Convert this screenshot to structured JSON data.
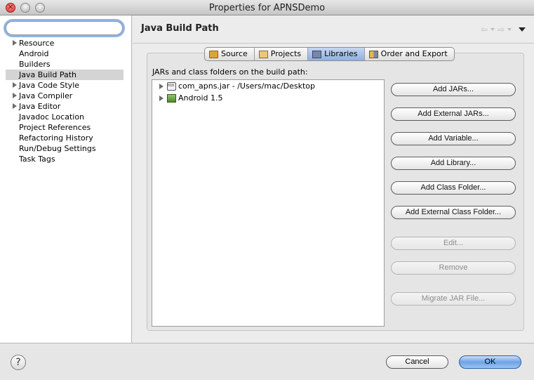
{
  "window": {
    "title": "Properties for APNSDemo"
  },
  "filter": {
    "placeholder": ""
  },
  "sidebar": {
    "items": [
      {
        "label": "Resource",
        "expandable": true
      },
      {
        "label": "Android",
        "expandable": false
      },
      {
        "label": "Builders",
        "expandable": false
      },
      {
        "label": "Java Build Path",
        "expandable": false,
        "selected": true
      },
      {
        "label": "Java Code Style",
        "expandable": true
      },
      {
        "label": "Java Compiler",
        "expandable": true
      },
      {
        "label": "Java Editor",
        "expandable": true
      },
      {
        "label": "Javadoc Location",
        "expandable": false
      },
      {
        "label": "Project References",
        "expandable": false
      },
      {
        "label": "Refactoring History",
        "expandable": false
      },
      {
        "label": "Run/Debug Settings",
        "expandable": false
      },
      {
        "label": "Task Tags",
        "expandable": false
      }
    ]
  },
  "page": {
    "title": "Java Build Path"
  },
  "tabs": [
    {
      "label": "Source",
      "icon": "source-folder-icon"
    },
    {
      "label": "Projects",
      "icon": "projects-icon"
    },
    {
      "label": "Libraries",
      "icon": "libraries-icon",
      "active": true
    },
    {
      "label": "Order and Export",
      "icon": "order-export-icon"
    }
  ],
  "libraries": {
    "section_label": "JARs and class folders on the build path:",
    "entries": [
      {
        "label": "com_apns.jar - /Users/mac/Desktop",
        "icon": "jar-icon"
      },
      {
        "label": "Android 1.5",
        "icon": "library-icon"
      }
    ],
    "buttons": {
      "add_jars": "Add JARs...",
      "add_external_jars": "Add External JARs...",
      "add_variable": "Add Variable...",
      "add_library": "Add Library...",
      "add_class_folder": "Add Class Folder...",
      "add_external_class_folder": "Add External Class Folder...",
      "edit": "Edit...",
      "remove": "Remove",
      "migrate_jar": "Migrate JAR File..."
    }
  },
  "footer": {
    "help": "?",
    "cancel": "Cancel",
    "ok": "OK"
  },
  "colors": {
    "accent": "#6fa3e4",
    "selection": "#d4d4d4",
    "active_tab": "#8fb0de"
  }
}
